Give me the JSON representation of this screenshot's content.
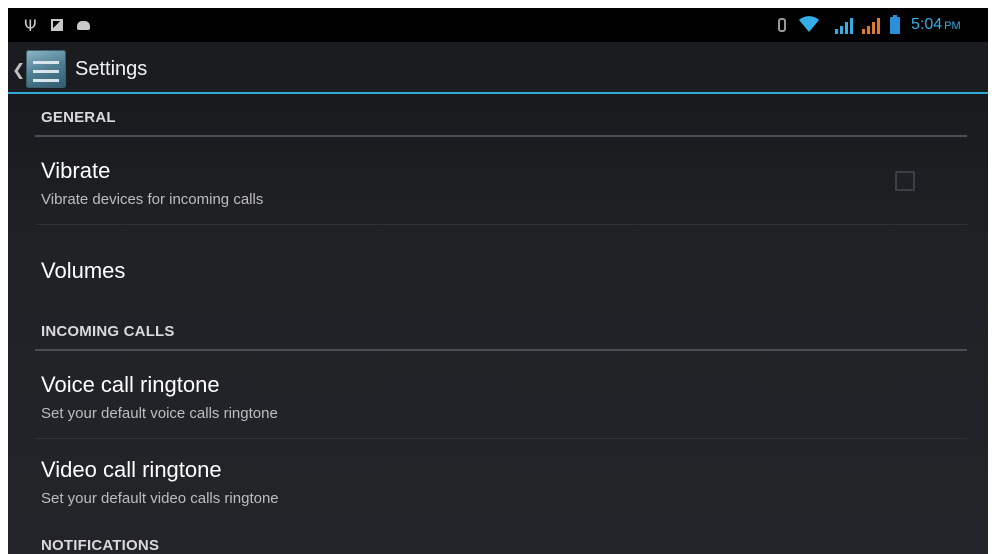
{
  "status_bar": {
    "left_icons": [
      "usb-icon",
      "image-notification-icon",
      "debug-bug-icon"
    ],
    "right_icons": [
      "bluetooth-icon",
      "wifi-icon",
      "signal-icon",
      "signal-icon",
      "battery-icon"
    ],
    "time": "5:04",
    "ampm": "PM",
    "accent_color": "#33aee6"
  },
  "action_bar": {
    "title": "Settings",
    "accent_line_color": "#33a9d8"
  },
  "sections": {
    "general": {
      "header": "GENERAL",
      "vibrate": {
        "title": "Vibrate",
        "summary": "Vibrate devices for incoming calls",
        "checked": false
      },
      "volumes": {
        "title": "Volumes"
      }
    },
    "incoming_calls": {
      "header": "INCOMING CALLS",
      "voice": {
        "title": "Voice call ringtone",
        "summary": "Set your default voice calls ringtone"
      },
      "video": {
        "title": "Video call ringtone",
        "summary": "Set your default video calls ringtone"
      }
    },
    "notifications": {
      "header": "NOTIFICATIONS"
    }
  }
}
